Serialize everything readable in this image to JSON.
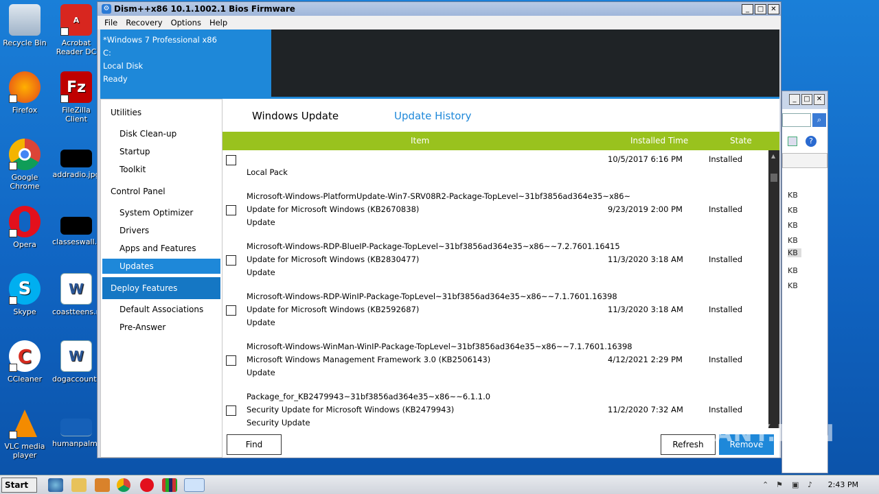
{
  "desktop": {
    "icons": [
      {
        "label": "Recycle Bin"
      },
      {
        "label": "Acrobat Reader DC"
      },
      {
        "label": "Firefox"
      },
      {
        "label": "FileZilla Client"
      },
      {
        "label": "Google Chrome"
      },
      {
        "label": "addradio.jpg"
      },
      {
        "label": "Opera"
      },
      {
        "label": "classeswall.jpg"
      },
      {
        "label": "Skype"
      },
      {
        "label": "coastteens.rtf"
      },
      {
        "label": "CCleaner"
      },
      {
        "label": "dogaccounti..."
      },
      {
        "label": "VLC media player"
      },
      {
        "label": "humanpalm..."
      }
    ]
  },
  "window": {
    "title": "Dism++x86 10.1.1002.1 Bios Firmware",
    "menu": [
      "File",
      "Recovery",
      "Options",
      "Help"
    ],
    "info": {
      "os": "*Windows 7 Professional x86",
      "drive": "C:",
      "disk": "Local Disk",
      "status": "Ready"
    }
  },
  "sidebar": {
    "utilities": "Utilities",
    "utilities_items": [
      "Disk Clean-up",
      "Startup",
      "Toolkit"
    ],
    "control_panel": "Control Panel",
    "control_items": [
      "System Optimizer",
      "Drivers",
      "Apps and Features",
      "Updates"
    ],
    "deploy": "Deploy Features",
    "deploy_items": [
      "Default Associations",
      "Pre-Answer"
    ]
  },
  "main": {
    "tabs": [
      "Windows Update",
      "Update History"
    ],
    "columns": {
      "item": "Item",
      "installed": "Installed Time",
      "state": "State"
    },
    "rows": [
      {
        "line1": "",
        "line2": "Local Pack",
        "line3": "",
        "time": "10/5/2017 6:16 PM",
        "state": "Installed"
      },
      {
        "line1": "Microsoft-Windows-PlatformUpdate-Win7-SRV08R2-Package-TopLevel~31bf3856ad364e35~x86~",
        "line2": "Update for Microsoft Windows (KB2670838)",
        "line3": "Update",
        "time": "9/23/2019 2:00 PM",
        "state": "Installed"
      },
      {
        "line1": "Microsoft-Windows-RDP-BlueIP-Package-TopLevel~31bf3856ad364e35~x86~~7.2.7601.16415",
        "line2": "Update for Microsoft Windows (KB2830477)",
        "line3": "Update",
        "time": "11/3/2020 3:18 AM",
        "state": "Installed"
      },
      {
        "line1": "Microsoft-Windows-RDP-WinIP-Package-TopLevel~31bf3856ad364e35~x86~~7.1.7601.16398",
        "line2": "Update for Microsoft Windows (KB2592687)",
        "line3": "Update",
        "time": "11/3/2020 3:18 AM",
        "state": "Installed"
      },
      {
        "line1": "Microsoft-Windows-WinMan-WinIP-Package-TopLevel~31bf3856ad364e35~x86~~7.1.7601.16398",
        "line2": "Microsoft Windows Management Framework 3.0 (KB2506143)",
        "line3": "Update",
        "time": "4/12/2021 2:29 PM",
        "state": "Installed"
      },
      {
        "line1": "Package_for_KB2479943~31bf3856ad364e35~x86~~6.1.1.0",
        "line2": "Security Update for Microsoft Windows (KB2479943)",
        "line3": "Security Update",
        "time": "11/2/2020 7:32 AM",
        "state": "Installed"
      }
    ],
    "buttons": {
      "find": "Find",
      "refresh": "Refresh",
      "remove": "Remove"
    }
  },
  "bg_window": {
    "sizes": [
      "KB",
      "KB",
      "KB",
      "KB",
      "KB",
      "KB",
      "KB"
    ]
  },
  "taskbar": {
    "start": "Start",
    "clock": "2:43 PM"
  },
  "watermark": "ANY.RUN"
}
